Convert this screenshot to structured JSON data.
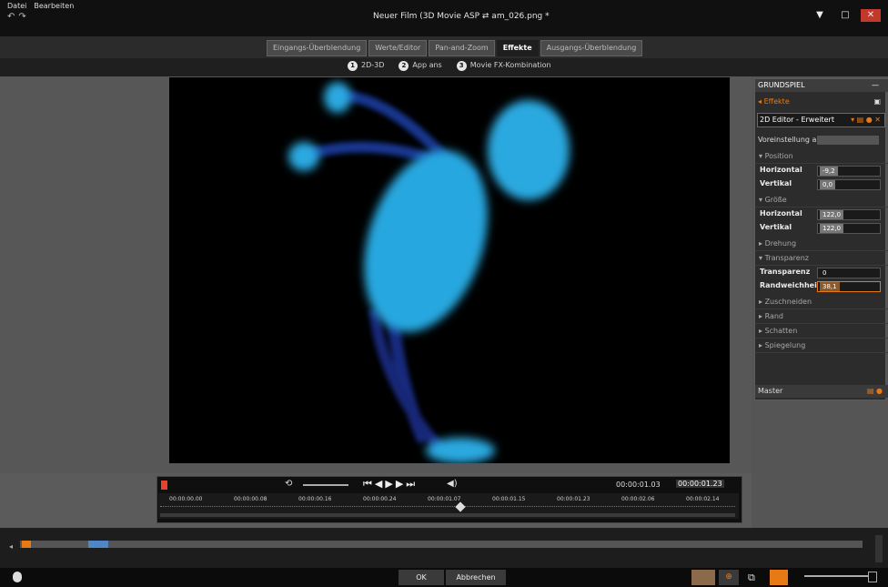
{
  "window": {
    "menu": [
      "Datei",
      "Bearbeiten"
    ],
    "title": "Neuer Film (3D Movie ASP ⇄ am_026.png *",
    "controls": [
      "▼",
      "□",
      "✕"
    ]
  },
  "tabs": [
    {
      "label": "Eingangs-Überblendung",
      "active": false
    },
    {
      "label": "Werte/Editor",
      "active": false
    },
    {
      "label": "Pan-and-Zoom",
      "active": false
    },
    {
      "label": "Effekte",
      "active": true
    },
    {
      "label": "Ausgangs-Überblendung",
      "active": false
    }
  ],
  "subtabs": [
    {
      "num": "1",
      "label": "2D-3D"
    },
    {
      "num": "2",
      "label": "App ans"
    },
    {
      "num": "3",
      "label": "Movie FX-Kombination"
    }
  ],
  "panel": {
    "header": "GRUNDSPIEL",
    "effect_link": "Effekte",
    "editor_select": "2D Editor - Erweitert",
    "preset_label": "Voreinstellung au",
    "sections": {
      "position": "Position",
      "scale": "Größe",
      "rotation": "Drehung",
      "transparency": "Transparenz",
      "crop": "Zuschneiden",
      "border": "Rand",
      "shadow": "Schatten",
      "reflection": "Spiegelung"
    },
    "fields": {
      "pos_h_label": "Horizontal",
      "pos_h": "-9,2",
      "pos_v_label": "Vertikal",
      "pos_v": "0,0",
      "size_h_label": "Horizontal",
      "size_h": "122,0",
      "size_v_label": "Vertikal",
      "size_v": "122,0",
      "transp_label": "Transparenz",
      "transp": "0",
      "edge_label": "Randweichheit",
      "edge": "38,1"
    },
    "footer": "Master"
  },
  "transport": {
    "timecode_total": "00:00:01.03",
    "timecode_current": "00:00:01.23",
    "ruler_ticks": [
      "00:00:00.00",
      "00:00:00.08",
      "00:00:00.16",
      "00:00:00.24",
      "00:00:01.07",
      "00:00:01.15",
      "00:00:01.23",
      "00:00:02.06",
      "00:00:02.14"
    ]
  },
  "bottom": {
    "ok": "OK",
    "cancel": "Abbrechen"
  },
  "colors": {
    "accent": "#e87a16",
    "figure": "#2aa9e0"
  }
}
